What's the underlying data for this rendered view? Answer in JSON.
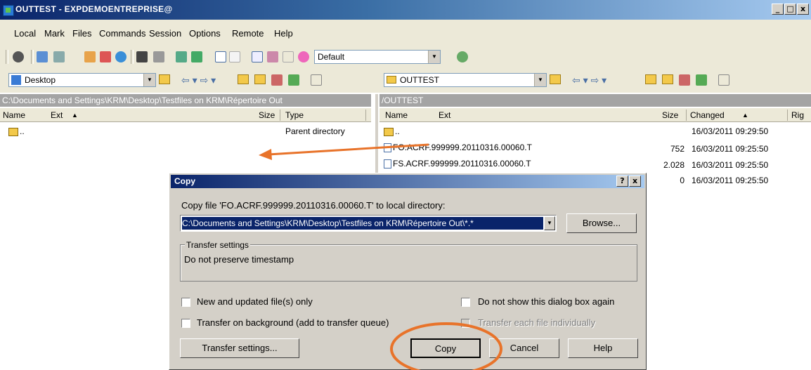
{
  "window": {
    "title": "OUTTEST - EXPDEMOENTREPRISE@",
    "caption_min": "_",
    "caption_max": "□",
    "caption_close": "x"
  },
  "menu": [
    "Local",
    "Mark",
    "Files",
    "Commands",
    "Session",
    "Options",
    "Remote",
    "Help"
  ],
  "toolbar": {
    "profile_select": "Default"
  },
  "left_panel": {
    "location": "Desktop",
    "path": "C:\\Documents and Settings\\KRM\\Desktop\\Testfiles on KRM\\Répertoire Out",
    "columns": {
      "name": "Name",
      "ext": "Ext",
      "size": "Size",
      "type": "Type"
    },
    "rows": [
      {
        "name": "..",
        "type": "Parent directory"
      }
    ]
  },
  "right_panel": {
    "location": "OUTTEST",
    "path": "/OUTTEST",
    "columns": {
      "name": "Name",
      "ext": "Ext",
      "size": "Size",
      "changed": "Changed",
      "rights": "Rig"
    },
    "rows": [
      {
        "name": "..",
        "size": "",
        "changed": "16/03/2011 09:29:50"
      },
      {
        "name": "FO.ACRF.999999.20110316.00060.T",
        "size": "752",
        "changed": "16/03/2011 09:25:50"
      },
      {
        "name": "FS.ACRF.999999.20110316.00060.T",
        "size": "2.028",
        "changed": "16/03/2011 09:25:50"
      },
      {
        "name": "",
        "size": "0",
        "changed": "16/03/2011 09:25:50"
      }
    ]
  },
  "dialog": {
    "title": "Copy",
    "help_btn": "?",
    "close_btn": "x",
    "prompt": "Copy file 'FO.ACRF.999999.20110316.00060.T' to local directory:",
    "target_path": "C:\\Documents and Settings\\KRM\\Desktop\\Testfiles on KRM\\Répertoire Out\\*.*",
    "browse_label": "Browse...",
    "transfer_group_label": "Transfer settings",
    "transfer_summary": "Do not preserve timestamp",
    "checkboxes": {
      "new_updated": "New and updated file(s) only",
      "background": "Transfer on background (add to transfer queue)",
      "dont_show": "Do not show this dialog box again",
      "individually": "Transfer each file individually"
    },
    "buttons": {
      "transfer_settings": "Transfer settings...",
      "copy": "Copy",
      "cancel": "Cancel",
      "help": "Help"
    }
  },
  "colors": {
    "annotation": "#e8732a"
  }
}
